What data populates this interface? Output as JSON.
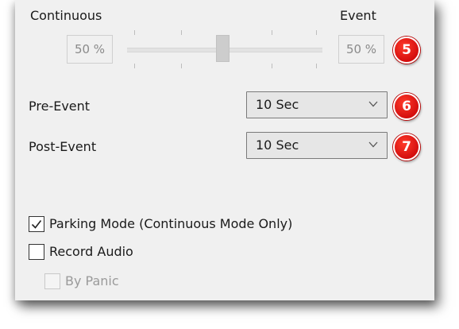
{
  "slider": {
    "left_label": "Continuous",
    "right_label": "Event",
    "left_value": "50 %",
    "right_value": "50 %",
    "position": 0.5
  },
  "pre_event": {
    "label": "Pre-Event",
    "value": "10 Sec"
  },
  "post_event": {
    "label": "Post-Event",
    "value": "10 Sec"
  },
  "badges": {
    "slider": "5",
    "pre_event": "6",
    "post_event": "7"
  },
  "options": {
    "parking_mode": {
      "label": "Parking Mode (Continuous Mode Only)",
      "checked": true
    },
    "record_audio": {
      "label": "Record Audio",
      "checked": false
    },
    "by_panic": {
      "label": "By Panic",
      "checked": false,
      "disabled": true
    }
  },
  "colors": {
    "panel_bg": "#f0f0f0",
    "badge": "#d40e0e",
    "disabled_text": "#9a9a9a"
  },
  "icons": {
    "dropdown": "chevron-down-icon",
    "check": "checkmark-icon"
  }
}
